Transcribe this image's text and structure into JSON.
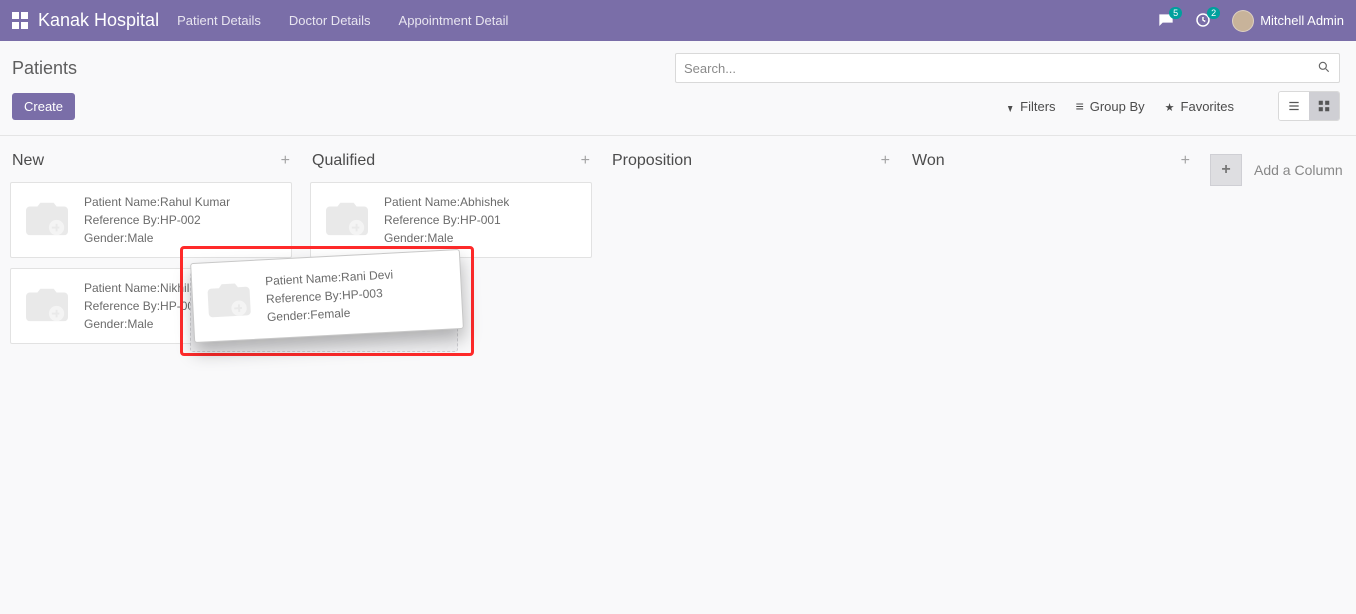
{
  "navbar": {
    "brand": "Kanak Hospital",
    "links": [
      "Patient Details",
      "Doctor Details",
      "Appointment Detail"
    ],
    "messages_badge": "5",
    "activities_badge": "2",
    "user_name": "Mitchell Admin"
  },
  "control_panel": {
    "title": "Patients",
    "create_label": "Create",
    "search_placeholder": "Search...",
    "filters_label": "Filters",
    "groupby_label": "Group By",
    "favorites_label": "Favorites",
    "add_column_label": "Add a Column"
  },
  "field_labels": {
    "patient_name": "Patient Name:",
    "reference_by": "Reference By:",
    "gender": "Gender:"
  },
  "columns": [
    {
      "title": "New",
      "cards": [
        {
          "name": "Rahul Kumar",
          "ref": "HP-002",
          "gender": "Male"
        },
        {
          "name": "Nikhil",
          "ref": "HP-004",
          "gender": "Male"
        }
      ]
    },
    {
      "title": "Qualified",
      "cards": [
        {
          "name": "Abhishek",
          "ref": "HP-001",
          "gender": "Male"
        }
      ]
    },
    {
      "title": "Proposition",
      "cards": []
    },
    {
      "title": "Won",
      "cards": []
    }
  ],
  "dragging_card": {
    "name": "Rani Devi",
    "ref": "HP-003",
    "gender": "Female"
  }
}
